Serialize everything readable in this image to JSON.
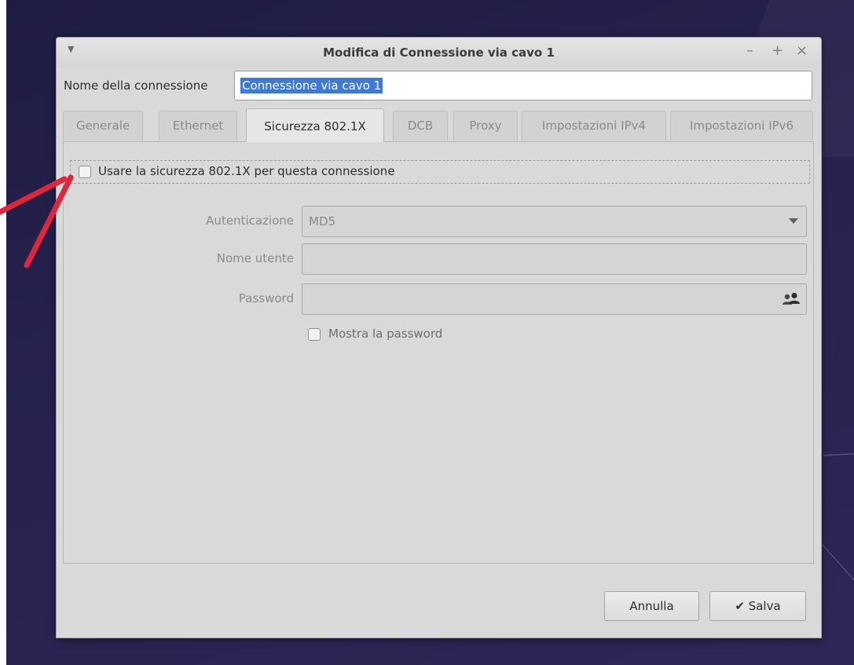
{
  "window": {
    "title": "Modifica di Connessione via cavo 1",
    "controls": {
      "minimize": "–",
      "maximize": "+",
      "close": "×"
    }
  },
  "connection_name": {
    "label": "Nome della connessione",
    "value": "Connessione via cavo 1"
  },
  "tabs": [
    {
      "label": "Generale"
    },
    {
      "label": "Ethernet"
    },
    {
      "label": "Sicurezza 802.1X"
    },
    {
      "label": "DCB"
    },
    {
      "label": "Proxy"
    },
    {
      "label": "Impostazioni IPv4"
    },
    {
      "label": "Impostazioni IPv6"
    }
  ],
  "active_tab": "Sicurezza 802.1X",
  "security": {
    "use_8021x_label": "Usare la sicurezza 802.1X per questa connessione",
    "use_8021x_checked": false,
    "auth_label": "Autenticazione",
    "auth_value": "MD5",
    "username_label": "Nome utente",
    "username_value": "",
    "password_label": "Password",
    "password_value": "",
    "show_password_label": "Mostra la password",
    "show_password_checked": false
  },
  "buttons": {
    "cancel": "Annulla",
    "save": "Salva"
  },
  "icons": {
    "menu": "chevron-down-icon",
    "password_owner": "users-icon",
    "save": "check-icon",
    "annotation": "red-arrow-icon"
  },
  "colors": {
    "selection": "#3e7ad2",
    "annotation_arrow": "#e0263a",
    "desktop": "#27224f",
    "window": "#d9d9d9"
  }
}
